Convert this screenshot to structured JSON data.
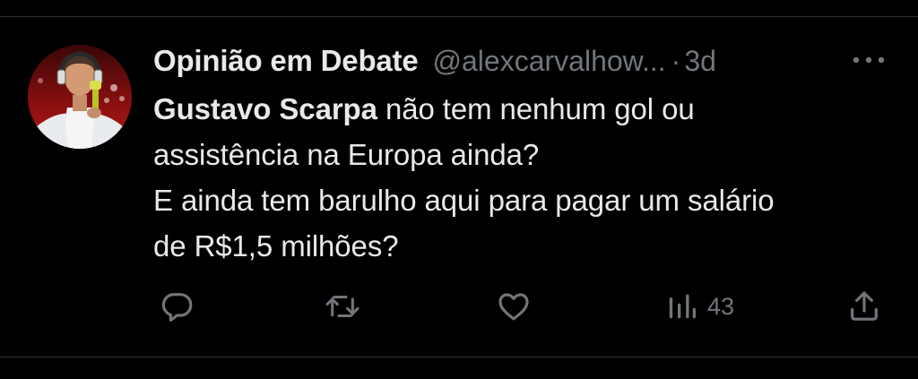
{
  "tweet": {
    "author_name": "Opinião em Debate",
    "handle": "@alexcarvalhow...",
    "separator": "·",
    "timestamp": "3d",
    "text": {
      "mention": "Gustavo Scarpa",
      "line1_rest": " não tem nenhum gol ou",
      "line2": "assistência na Europa ainda?",
      "line3": "E ainda tem barulho aqui para pagar um salário",
      "line4": "de R$1,5 milhões?"
    }
  },
  "actions": {
    "reply_icon": "reply-icon",
    "retweet_icon": "retweet-icon",
    "like_icon": "heart-icon",
    "views_icon": "views-icon",
    "views_count": "43",
    "share_icon": "share-icon"
  },
  "colors": {
    "background": "#000000",
    "text_primary": "#e7e9ea",
    "text_secondary": "#71767b",
    "divider": "#2f3336"
  }
}
